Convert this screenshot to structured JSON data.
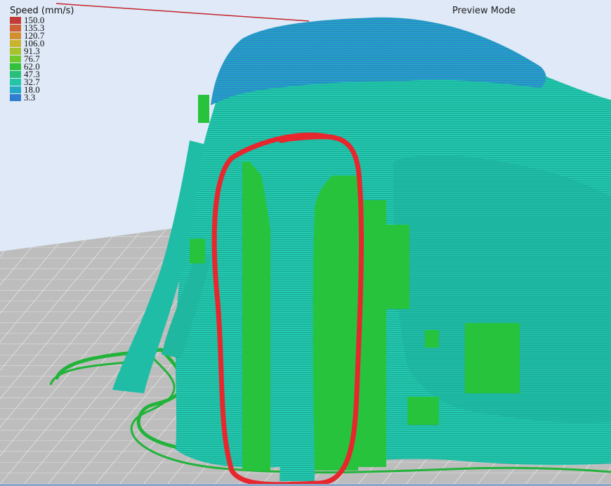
{
  "viewer": {
    "mode_label": "Preview Mode"
  },
  "legend": {
    "title": "Speed (mm/s)",
    "items": [
      {
        "label": "150.0",
        "color": "#c43a36"
      },
      {
        "label": "135.3",
        "color": "#cf6233"
      },
      {
        "label": "120.7",
        "color": "#d28f2e"
      },
      {
        "label": "106.0",
        "color": "#c9b42c"
      },
      {
        "label": "91.3",
        "color": "#a7c22a"
      },
      {
        "label": "76.7",
        "color": "#6fc92c"
      },
      {
        "label": "62.0",
        "color": "#2fc23a"
      },
      {
        "label": "47.3",
        "color": "#27c07a"
      },
      {
        "label": "32.7",
        "color": "#23c4a8"
      },
      {
        "label": "18.0",
        "color": "#22a9c3"
      },
      {
        "label": "3.3",
        "color": "#2f7dd1"
      }
    ]
  },
  "colors": {
    "background": "#dfe9f7",
    "bed": "#b9b9b9",
    "model_teal": "#23c9b0",
    "support_green": "#27c33c",
    "top_blue": "#2d86d3",
    "annotation_red": "#e8262e"
  }
}
